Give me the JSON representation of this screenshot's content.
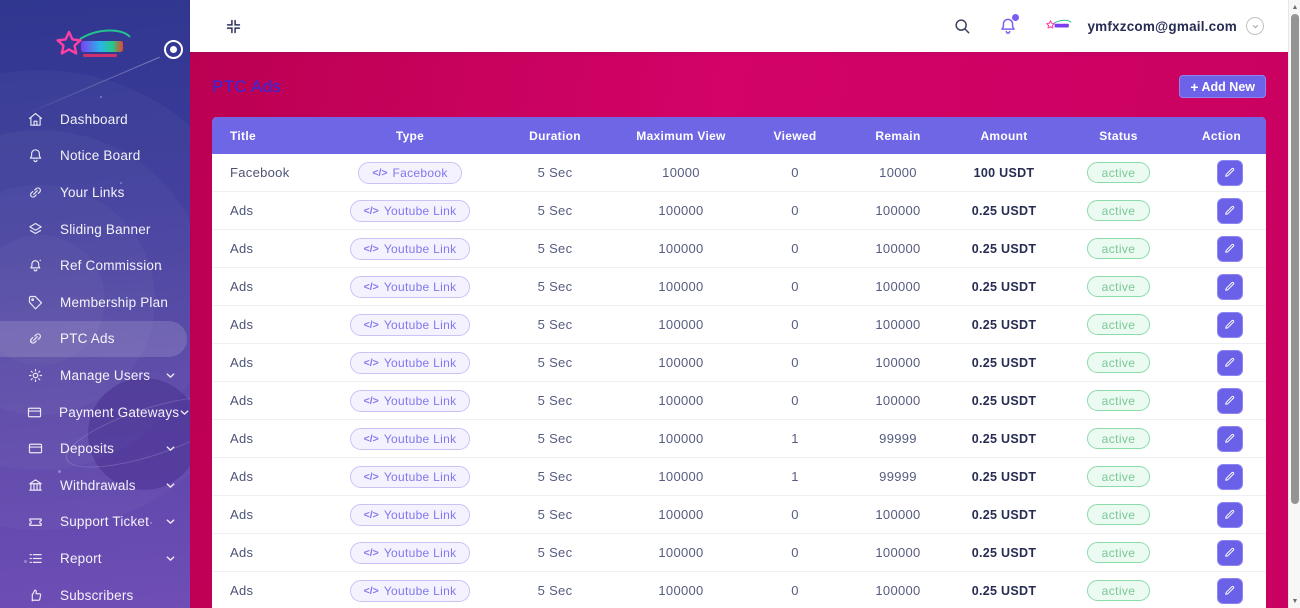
{
  "sidebar": {
    "items": [
      {
        "label": "Dashboard",
        "icon": "home-icon",
        "active": false,
        "expandable": false
      },
      {
        "label": "Notice Board",
        "icon": "bell-icon",
        "active": false,
        "expandable": false
      },
      {
        "label": "Your Links",
        "icon": "link-icon",
        "active": false,
        "expandable": false
      },
      {
        "label": "Sliding Banner",
        "icon": "layers-icon",
        "active": false,
        "expandable": false
      },
      {
        "label": "Ref Commission",
        "icon": "bell-badge-icon",
        "active": false,
        "expandable": false
      },
      {
        "label": "Membership Plan",
        "icon": "tag-icon",
        "active": false,
        "expandable": false
      },
      {
        "label": "PTC Ads",
        "icon": "link-icon",
        "active": true,
        "expandable": false
      },
      {
        "label": "Manage Users",
        "icon": "gear-icon",
        "active": false,
        "expandable": true
      },
      {
        "label": "Payment Gateways",
        "icon": "credit-card-icon",
        "active": false,
        "expandable": true
      },
      {
        "label": "Deposits",
        "icon": "credit-card-icon",
        "active": false,
        "expandable": true
      },
      {
        "label": "Withdrawals",
        "icon": "bank-icon",
        "active": false,
        "expandable": true
      },
      {
        "label": "Support Ticket",
        "icon": "ticket-icon",
        "active": false,
        "expandable": true
      },
      {
        "label": "Report",
        "icon": "list-icon",
        "active": false,
        "expandable": true
      },
      {
        "label": "Subscribers",
        "icon": "thumbs-up-icon",
        "active": false,
        "expandable": false
      }
    ]
  },
  "topbar": {
    "email": "ymfxzcom@gmail.com",
    "icons": [
      "compress-icon",
      "search-icon",
      "bell-icon",
      "avatar-logo",
      "chevron-down-icon"
    ]
  },
  "page": {
    "title": "PTC Ads",
    "add_new_label": "Add New",
    "add_new_plus": "+"
  },
  "table": {
    "columns": [
      "Title",
      "Type",
      "Duration",
      "Maximum View",
      "Viewed",
      "Remain",
      "Amount",
      "Status",
      "Action"
    ],
    "type_code_glyph": "</>",
    "rows": [
      {
        "title": "Facebook",
        "type": "Facebook",
        "duration": "5 Sec",
        "maximum_view": "10000",
        "viewed": "0",
        "remain": "10000",
        "amount": "100 USDT",
        "status": "active"
      },
      {
        "title": "Ads",
        "type": "Youtube Link",
        "duration": "5 Sec",
        "maximum_view": "100000",
        "viewed": "0",
        "remain": "100000",
        "amount": "0.25 USDT",
        "status": "active"
      },
      {
        "title": "Ads",
        "type": "Youtube Link",
        "duration": "5 Sec",
        "maximum_view": "100000",
        "viewed": "0",
        "remain": "100000",
        "amount": "0.25 USDT",
        "status": "active"
      },
      {
        "title": "Ads",
        "type": "Youtube Link",
        "duration": "5 Sec",
        "maximum_view": "100000",
        "viewed": "0",
        "remain": "100000",
        "amount": "0.25 USDT",
        "status": "active"
      },
      {
        "title": "Ads",
        "type": "Youtube Link",
        "duration": "5 Sec",
        "maximum_view": "100000",
        "viewed": "0",
        "remain": "100000",
        "amount": "0.25 USDT",
        "status": "active"
      },
      {
        "title": "Ads",
        "type": "Youtube Link",
        "duration": "5 Sec",
        "maximum_view": "100000",
        "viewed": "0",
        "remain": "100000",
        "amount": "0.25 USDT",
        "status": "active"
      },
      {
        "title": "Ads",
        "type": "Youtube Link",
        "duration": "5 Sec",
        "maximum_view": "100000",
        "viewed": "0",
        "remain": "100000",
        "amount": "0.25 USDT",
        "status": "active"
      },
      {
        "title": "Ads",
        "type": "Youtube Link",
        "duration": "5 Sec",
        "maximum_view": "100000",
        "viewed": "1",
        "remain": "99999",
        "amount": "0.25 USDT",
        "status": "active"
      },
      {
        "title": "Ads",
        "type": "Youtube Link",
        "duration": "5 Sec",
        "maximum_view": "100000",
        "viewed": "1",
        "remain": "99999",
        "amount": "0.25 USDT",
        "status": "active"
      },
      {
        "title": "Ads",
        "type": "Youtube Link",
        "duration": "5 Sec",
        "maximum_view": "100000",
        "viewed": "0",
        "remain": "100000",
        "amount": "0.25 USDT",
        "status": "active"
      },
      {
        "title": "Ads",
        "type": "Youtube Link",
        "duration": "5 Sec",
        "maximum_view": "100000",
        "viewed": "0",
        "remain": "100000",
        "amount": "0.25 USDT",
        "status": "active"
      },
      {
        "title": "Ads",
        "type": "Youtube Link",
        "duration": "5 Sec",
        "maximum_view": "100000",
        "viewed": "0",
        "remain": "100000",
        "amount": "0.25 USDT",
        "status": "active"
      }
    ]
  },
  "colors": {
    "accent_purple": "#6c63e8",
    "content_pink": "#cb0160",
    "title_blue": "#2a2ce2",
    "status_green": "#79c795",
    "sidebar_gradient_top": "#30378f",
    "sidebar_gradient_bottom": "#6f4eb6"
  }
}
